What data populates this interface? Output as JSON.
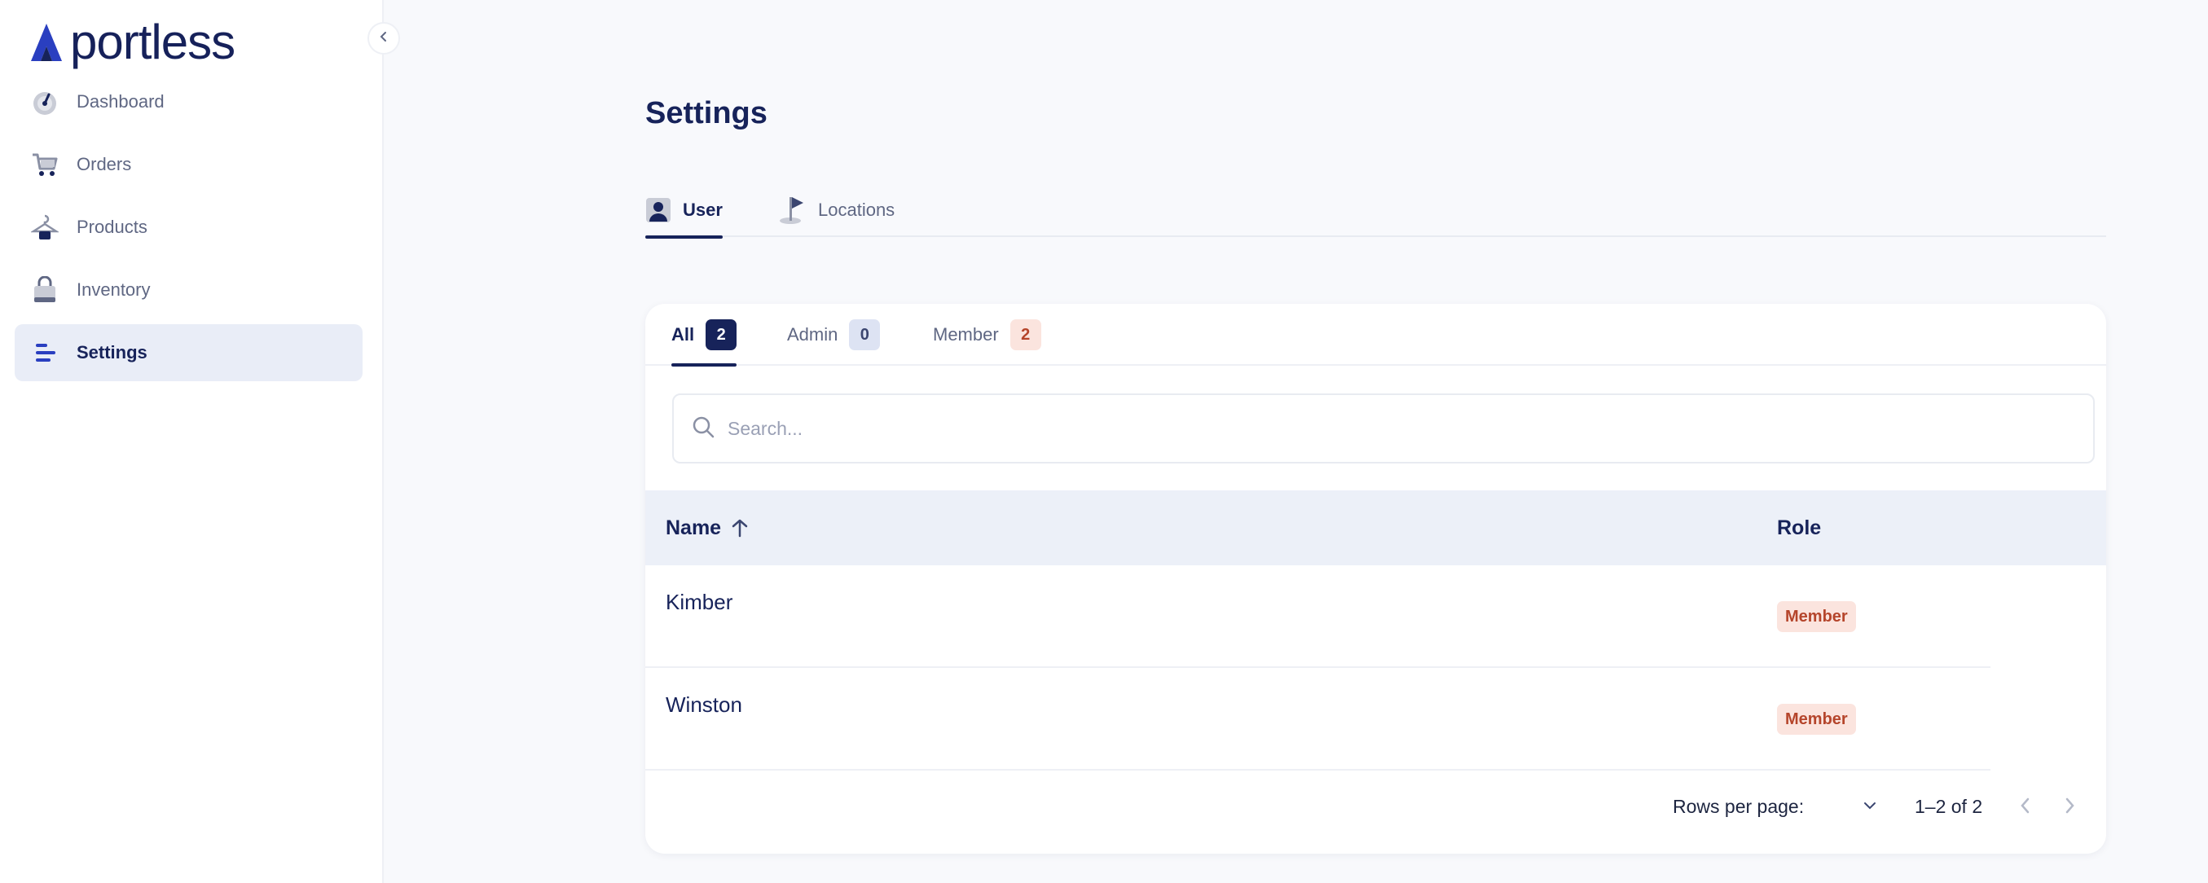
{
  "brand": {
    "name": "portless",
    "color": "#17235a",
    "accent": "#2a3fc0"
  },
  "sidebar": {
    "items": [
      {
        "label": "Dashboard",
        "icon": "gauge-icon"
      },
      {
        "label": "Orders",
        "icon": "cart-icon"
      },
      {
        "label": "Products",
        "icon": "hanger-icon"
      },
      {
        "label": "Inventory",
        "icon": "bag-icon"
      },
      {
        "label": "Settings",
        "icon": "settings-lines-icon",
        "active": true
      }
    ]
  },
  "page": {
    "title": "Settings",
    "tabs": [
      {
        "label": "User",
        "icon": "user-icon",
        "active": true
      },
      {
        "label": "Locations",
        "icon": "flag-icon"
      }
    ]
  },
  "filters": [
    {
      "label": "All",
      "count": "2",
      "active": true
    },
    {
      "label": "Admin",
      "count": "0"
    },
    {
      "label": "Member",
      "count": "2"
    }
  ],
  "search": {
    "placeholder": "Search...",
    "value": ""
  },
  "table": {
    "columns": [
      "Name",
      "Role"
    ],
    "rows": [
      {
        "name": "Kimber",
        "role": "Member"
      },
      {
        "name": "Winston",
        "role": "Member"
      }
    ]
  },
  "pagination": {
    "rows_per_page_label": "Rows per page:",
    "rows_per_page_value": "",
    "range": "1–2 of 2"
  }
}
